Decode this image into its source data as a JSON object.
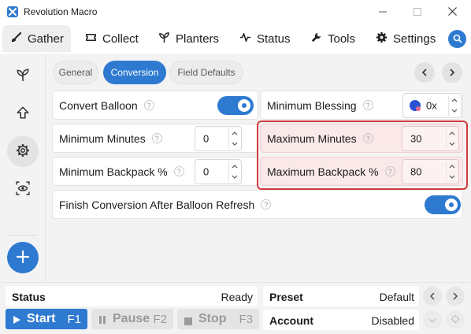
{
  "window": {
    "title": "Revolution Macro",
    "icons": {
      "logo": "app-logo",
      "minimize": "minimize-icon",
      "maximize": "maximize-icon",
      "close": "close-icon"
    }
  },
  "tabs": [
    {
      "label": "Gather",
      "icon": "brush-icon",
      "active": true
    },
    {
      "label": "Collect",
      "icon": "ticket-icon",
      "active": false
    },
    {
      "label": "Planters",
      "icon": "sprout-icon",
      "active": false
    },
    {
      "label": "Status",
      "icon": "pulse-icon",
      "active": false
    },
    {
      "label": "Tools",
      "icon": "wrench-icon",
      "active": false
    },
    {
      "label": "Settings",
      "icon": "gear-icon",
      "active": false
    }
  ],
  "sidebar": {
    "items": [
      {
        "icon": "sprout-icon"
      },
      {
        "icon": "arrow-up-icon"
      },
      {
        "icon": "settings-gear-icon",
        "active": true
      },
      {
        "icon": "scan-eye-icon"
      }
    ],
    "add_icon": "plus-icon"
  },
  "subtabs": [
    {
      "label": "General",
      "active": false
    },
    {
      "label": "Conversion",
      "active": true
    },
    {
      "label": "Field Defaults",
      "active": false
    }
  ],
  "settings": {
    "convert_balloon": {
      "label": "Convert Balloon",
      "help": "?",
      "enabled": true
    },
    "minimum_blessing": {
      "label": "Minimum Blessing",
      "help": "?",
      "value": "0x"
    },
    "minimum_minutes": {
      "label": "Minimum Minutes",
      "help": "?",
      "value": "0"
    },
    "maximum_minutes": {
      "label": "Maximum Minutes",
      "help": "?",
      "value": "30"
    },
    "minimum_backpack": {
      "label": "Minimum Backpack %",
      "help": "?",
      "value": "0"
    },
    "maximum_backpack": {
      "label": "Maximum Backpack %",
      "help": "?",
      "value": "80"
    },
    "finish_conversion": {
      "label": "Finish Conversion After Balloon Refresh",
      "help": "?",
      "enabled": true
    }
  },
  "bottom": {
    "status_label": "Status",
    "status_value": "Ready",
    "start": {
      "label": "Start",
      "key": "F1"
    },
    "pause": {
      "label": "Pause",
      "key": "F2"
    },
    "stop": {
      "label": "Stop",
      "key": "F3"
    },
    "preset_label": "Preset",
    "preset_value": "Default",
    "account_label": "Account",
    "account_value": "Disabled"
  },
  "colors": {
    "accent": "#2e7ad1",
    "highlight_bg": "#fbe9e9",
    "highlight_border": "#d23a3a"
  }
}
